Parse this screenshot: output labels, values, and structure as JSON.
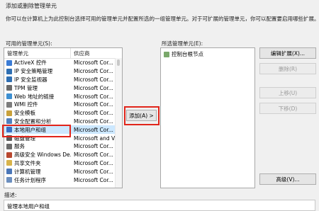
{
  "dialog": {
    "title": "添加或删除管理单元",
    "instruction": "你可以在计算机上为此控制台选择可用的管理单元并配置所选的一组管理单元。对于可扩展的管理单元，你可以配置要启用哪些扩展。"
  },
  "available": {
    "label": "可用的管理单元(S):",
    "columns": [
      "管理单元",
      "供应商"
    ],
    "items": [
      {
        "name": "ActiveX 控件",
        "vendor": "Microsoft Cor...",
        "icon": "activex-icon",
        "color": "#3a7bd5"
      },
      {
        "name": "IP 安全策略管理",
        "vendor": "Microsoft Cor...",
        "icon": "ip-policy-icon",
        "color": "#2f6fb3"
      },
      {
        "name": "IP 安全监视器",
        "vendor": "Microsoft Cor...",
        "icon": "ip-monitor-icon",
        "color": "#2f6fb3"
      },
      {
        "name": "TPM 管理",
        "vendor": "Microsoft Cor...",
        "icon": "tpm-icon",
        "color": "#6a6a6a"
      },
      {
        "name": "Web 地址的链接",
        "vendor": "Microsoft Cor...",
        "icon": "web-link-icon",
        "color": "#3d8fd1"
      },
      {
        "name": "WMI 控件",
        "vendor": "Microsoft Cor...",
        "icon": "wmi-icon",
        "color": "#7c7c7c"
      },
      {
        "name": "安全模板",
        "vendor": "Microsoft Cor...",
        "icon": "security-template-icon",
        "color": "#c9a13b"
      },
      {
        "name": "安全配置和分析",
        "vendor": "Microsoft Cor...",
        "icon": "security-analysis-icon",
        "color": "#4f7fbf"
      },
      {
        "name": "本地用户和组",
        "vendor": "Microsoft Cor...",
        "icon": "users-groups-icon",
        "color": "#3a6fc4"
      },
      {
        "name": "磁盘管理",
        "vendor": "Microsoft and V...",
        "icon": "disk-icon",
        "color": "#5b5b5b"
      },
      {
        "name": "服务",
        "vendor": "Microsoft Cor...",
        "icon": "services-icon",
        "color": "#6b6b6b"
      },
      {
        "name": "高级安全 Windows De...",
        "vendor": "Microsoft Cor...",
        "icon": "firewall-icon",
        "color": "#b8472f"
      },
      {
        "name": "共享文件夹",
        "vendor": "Microsoft Cor...",
        "icon": "shared-folder-icon",
        "color": "#d8b34a"
      },
      {
        "name": "计算机管理",
        "vendor": "Microsoft Cor...",
        "icon": "computer-management-icon",
        "color": "#4a76b8"
      },
      {
        "name": "任务计划程序",
        "vendor": "Microsoft Cor...",
        "icon": "task-scheduler-icon",
        "color": "#6c8fbf"
      }
    ]
  },
  "add_button": "添加(A) >",
  "selected": {
    "label": "所选管理单元(E):",
    "items": [
      "控制台根节点"
    ]
  },
  "side_buttons": {
    "edit_extensions": "编辑扩展(X)...",
    "remove": "删除(R)",
    "move_up": "上移(U)",
    "move_down": "下移(D)",
    "advanced": "高级(V)..."
  },
  "description": {
    "label": "描述:",
    "text": "管理本地用户和组"
  }
}
